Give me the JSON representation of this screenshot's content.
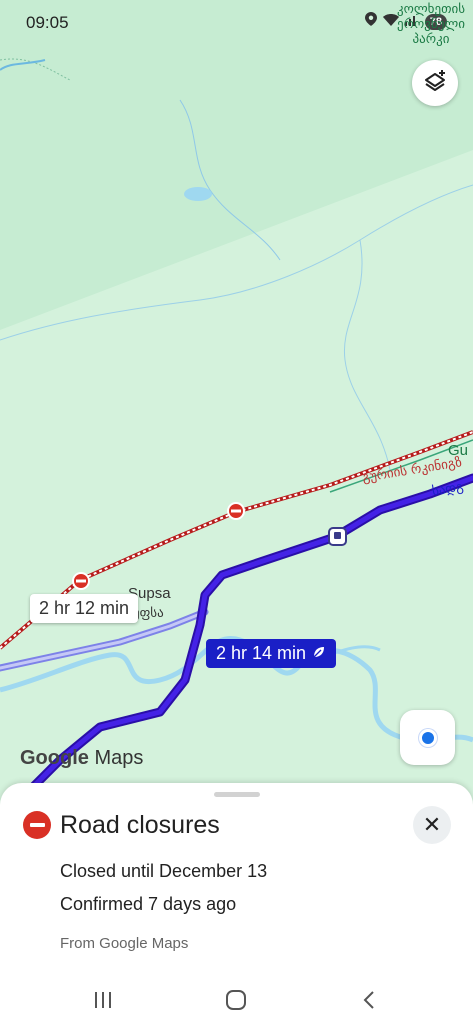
{
  "status_bar": {
    "time": "09:05",
    "battery": "78"
  },
  "map": {
    "place_top_right": [
      "კოლხეთის",
      "ეროვნული",
      "პარკი"
    ],
    "label_supsa": "Supsa",
    "label_supsa_geo": "სუფსა",
    "label_gu": "Gu",
    "road_label_geo": "გურიის რკინიგზ",
    "road_label_geo2": "სადგ",
    "route_alt_time": "2 hr 12 min",
    "route_main_time": "2 hr 14 min",
    "logo_text_google": "Google",
    "logo_text_maps": "Maps",
    "colors": {
      "route_main": "#3b16d6",
      "route_alt": "#7d82e8",
      "closure": "#d93025",
      "land": "#d4f2dc",
      "water": "#9fd8f0"
    }
  },
  "sheet": {
    "title": "Road closures",
    "closed_until": "Closed until December 13",
    "confirmed": "Confirmed 7 days ago",
    "source": "From Google Maps",
    "close_symbol": "✕"
  },
  "nav_bar": {
    "recents": "|||",
    "home": "○",
    "back": "‹"
  }
}
